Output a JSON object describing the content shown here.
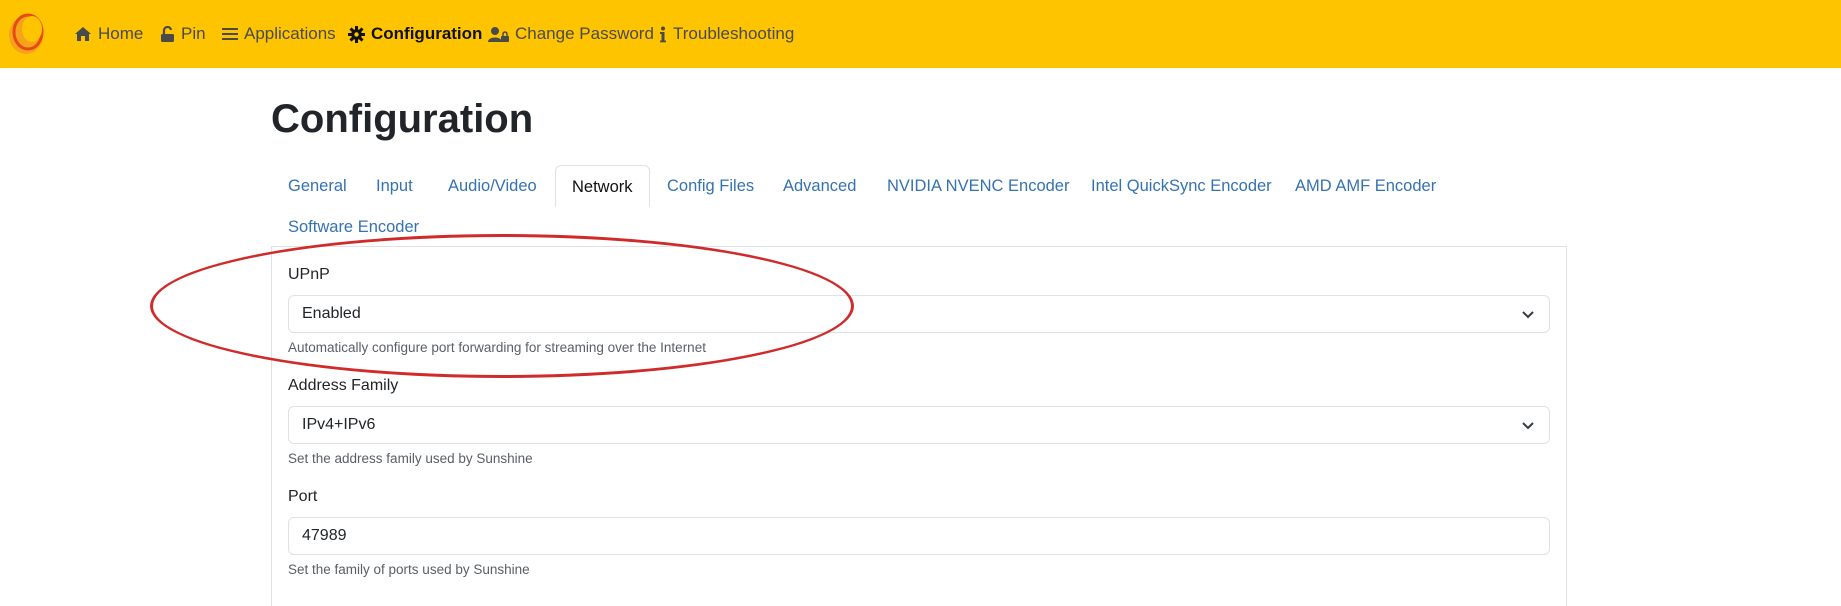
{
  "nav": {
    "items": [
      {
        "label": "Home",
        "icon": "home-icon"
      },
      {
        "label": "Pin",
        "icon": "unlock-icon"
      },
      {
        "label": "Applications",
        "icon": "list-icon"
      },
      {
        "label": "Configuration",
        "icon": "gear-icon",
        "active": true
      },
      {
        "label": "Change Password",
        "icon": "user-lock-icon"
      },
      {
        "label": "Troubleshooting",
        "icon": "info-icon"
      }
    ]
  },
  "page": {
    "title": "Configuration"
  },
  "tabs": [
    {
      "label": "General"
    },
    {
      "label": "Input"
    },
    {
      "label": "Audio/Video"
    },
    {
      "label": "Network",
      "active": true
    },
    {
      "label": "Config Files"
    },
    {
      "label": "Advanced"
    },
    {
      "label": "NVIDIA NVENC Encoder"
    },
    {
      "label": "Intel QuickSync Encoder"
    },
    {
      "label": "AMD AMF Encoder"
    },
    {
      "label": "Software Encoder"
    }
  ],
  "fields": {
    "upnp": {
      "label": "UPnP",
      "value": "Enabled",
      "help": "Automatically configure port forwarding for streaming over the Internet"
    },
    "address_family": {
      "label": "Address Family",
      "value": "IPv4+IPv6",
      "help": "Set the address family used by Sunshine"
    },
    "port": {
      "label": "Port",
      "value": "47989",
      "help": "Set the family of ports used by Sunshine"
    }
  },
  "colors": {
    "navbar": "#ffc400",
    "link": "#3572b0",
    "annotation": "#d02a2a"
  }
}
